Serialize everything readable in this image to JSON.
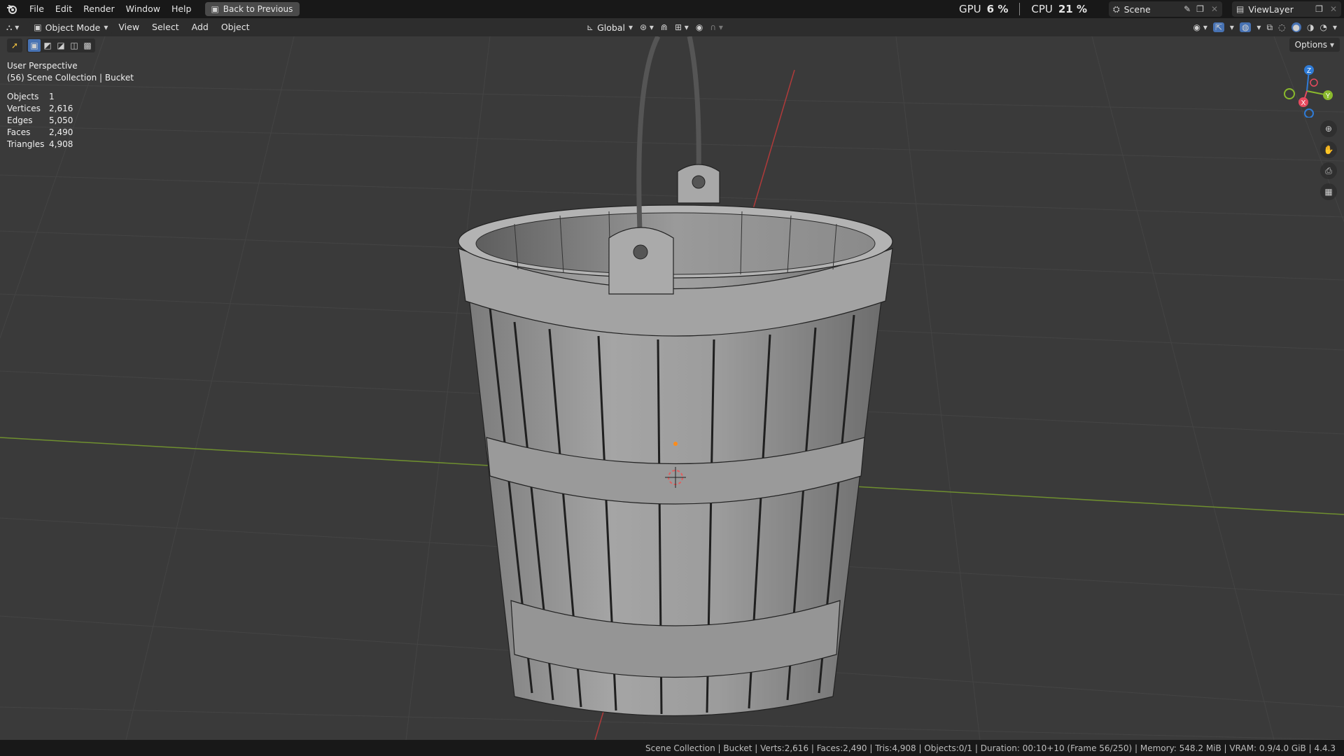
{
  "menu": {
    "items": [
      "File",
      "Edit",
      "Render",
      "Window",
      "Help"
    ],
    "back_button": "Back to Previous"
  },
  "performance": {
    "gpu_label": "GPU",
    "gpu_value": "6 %",
    "cpu_label": "CPU",
    "cpu_value": "21 %"
  },
  "scene": {
    "name": "Scene",
    "view_layer": "ViewLayer"
  },
  "header": {
    "mode": "Object Mode",
    "menus": [
      "View",
      "Select",
      "Add",
      "Object"
    ],
    "transform_orientation": "Global"
  },
  "viewport": {
    "view_name": "User Perspective",
    "collection_info": "(56) Scene Collection | Bucket",
    "stats": [
      {
        "label": "Objects",
        "value": "1"
      },
      {
        "label": "Vertices",
        "value": "2,616"
      },
      {
        "label": "Edges",
        "value": "5,050"
      },
      {
        "label": "Faces",
        "value": "2,490"
      },
      {
        "label": "Triangles",
        "value": "4,908"
      }
    ],
    "options_label": "Options",
    "gizmo_labels": {
      "z": "Z",
      "y": "Y",
      "x": "X"
    }
  },
  "statusbar": {
    "text": "Scene Collection | Bucket | Verts:2,616 | Faces:2,490 | Tris:4,908 | Objects:0/1 | Duration: 00:10+10 (Frame 56/250) | Memory: 548.2 MiB | VRAM: 0.9/4.0 GiB | 4.4.3"
  },
  "colors": {
    "accent": "#4772b3",
    "x_axis": "#e84a5f",
    "y_axis": "#8ab92d",
    "z_axis": "#2f7bd6",
    "background": "#3a3a3a"
  }
}
